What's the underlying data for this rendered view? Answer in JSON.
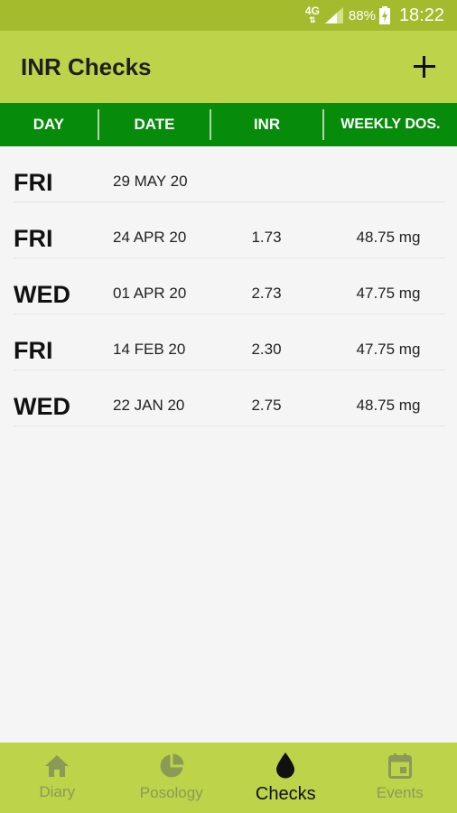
{
  "status_bar": {
    "network": "4G",
    "network_arrows": "⇅",
    "battery": "88%",
    "time": "18:22"
  },
  "app_bar": {
    "title": "INR Checks",
    "add_icon": "plus-icon"
  },
  "table": {
    "headers": [
      "DAY",
      "DATE",
      "INR",
      "WEEKLY DOS."
    ],
    "rows": [
      {
        "day": "FRI",
        "date": "29 MAY 20",
        "inr": "",
        "dose": ""
      },
      {
        "day": "FRI",
        "date": "24 APR 20",
        "inr": "1.73",
        "dose": "48.75 mg"
      },
      {
        "day": "WED",
        "date": "01 APR 20",
        "inr": "2.73",
        "dose": "47.75 mg"
      },
      {
        "day": "FRI",
        "date": "14 FEB 20",
        "inr": "2.30",
        "dose": "47.75 mg"
      },
      {
        "day": "WED",
        "date": "22 JAN 20",
        "inr": "2.75",
        "dose": "48.75 mg"
      }
    ]
  },
  "bottom_nav": {
    "items": [
      {
        "label": "Diary",
        "icon": "home-icon"
      },
      {
        "label": "Posology",
        "icon": "pie-chart-icon"
      },
      {
        "label": "Checks",
        "icon": "drop-icon",
        "active": true
      },
      {
        "label": "Events",
        "icon": "calendar-icon"
      }
    ]
  },
  "colors": {
    "status_bar": "#a3bb2c",
    "app_bar": "#bcd34a",
    "header_green": "#078b0b",
    "background": "#f5f5f5"
  }
}
